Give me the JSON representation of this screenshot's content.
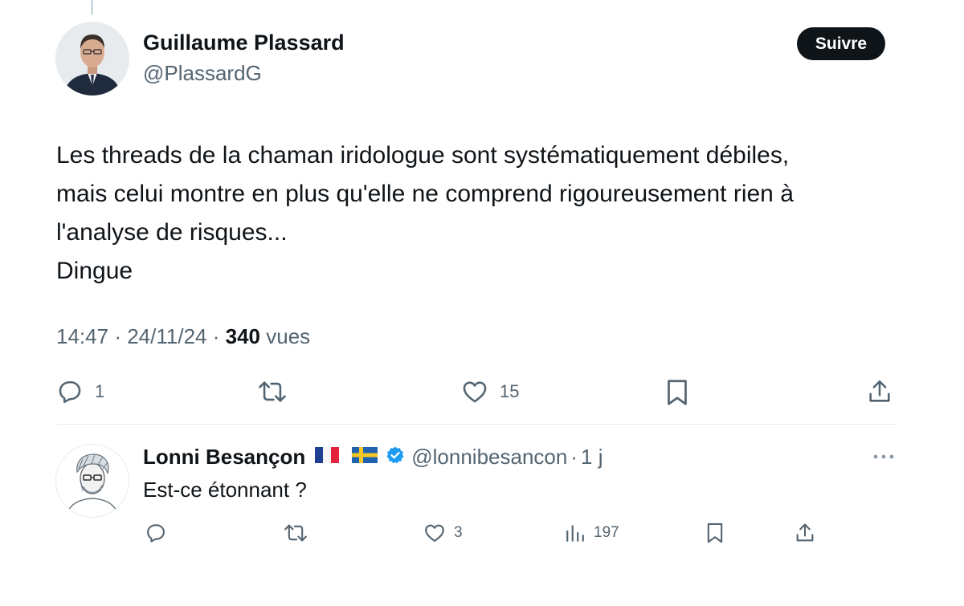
{
  "tweet": {
    "author_name": "Guillaume Plassard",
    "author_handle": "@PlassardG",
    "follow_label": "Suivre",
    "text_lines": [
      "Les threads de la chaman iridologue sont systématiquement débiles,",
      "mais celui montre en plus qu'elle ne comprend rigoureusement rien à",
      "l'analyse de risques...",
      "Dingue"
    ],
    "time": "14:47",
    "separator": "·",
    "date": "24/11/24",
    "views_count": "340",
    "views_label": "vues",
    "actions": {
      "reply_count": "1",
      "retweet_count": "",
      "like_count": "15"
    }
  },
  "reply": {
    "author_name": "Lonni Besançon",
    "flags": [
      "france-flag",
      "sweden-flag"
    ],
    "verified_icon": "verified-badge-icon",
    "handle": "@lonnibesancon",
    "separator": "·",
    "time": "1 j",
    "text": "Est-ce étonnant ?",
    "actions": {
      "reply_count": "",
      "retweet_count": "",
      "like_count": "3",
      "views_count": "197"
    }
  },
  "colors": {
    "text_primary": "#0f1419",
    "text_secondary": "#536471",
    "follow_bg": "#0f1419",
    "verified": "#1d9bf0",
    "divider": "#e6e9ea"
  }
}
